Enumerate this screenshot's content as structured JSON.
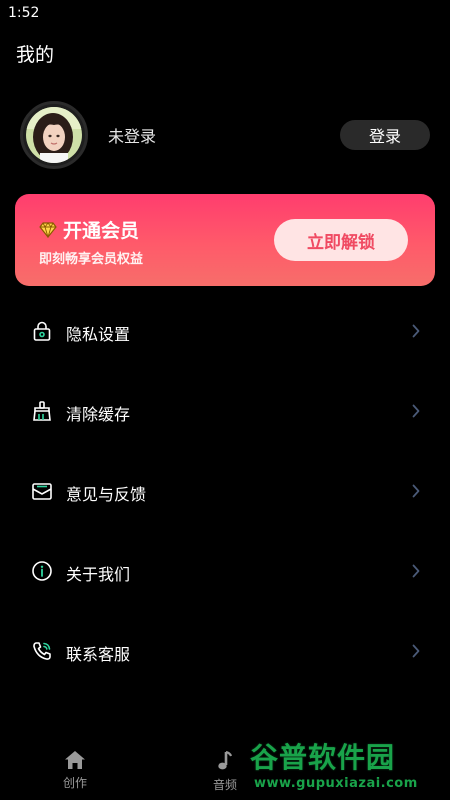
{
  "status_bar": {
    "time": "1:52"
  },
  "page": {
    "title": "我的"
  },
  "profile": {
    "username": "未登录",
    "login_label": "登录"
  },
  "vip": {
    "title": "开通会员",
    "subtitle": "即刻畅享会员权益",
    "button_label": "立即解锁",
    "icon": "diamond-icon",
    "colors": {
      "gradient_top": "#ff3d6e",
      "gradient_bottom": "#f76e6a",
      "button_bg": "#ffe4e4",
      "button_text": "#f04a62"
    }
  },
  "menu": {
    "items": [
      {
        "label": "隐私设置",
        "icon": "lock-icon"
      },
      {
        "label": "清除缓存",
        "icon": "broom-icon"
      },
      {
        "label": "意见与反馈",
        "icon": "mail-icon"
      },
      {
        "label": "关于我们",
        "icon": "info-icon"
      },
      {
        "label": "联系客服",
        "icon": "phone-icon"
      }
    ],
    "accent_color": "#2fd6a0"
  },
  "tab_bar": {
    "tabs": [
      {
        "label": "创作",
        "icon": "home-icon"
      },
      {
        "label": "音频",
        "icon": "music-note-icon"
      }
    ]
  },
  "watermark": {
    "title": "谷普软件园",
    "url": "www.gupuxiazai.com"
  }
}
